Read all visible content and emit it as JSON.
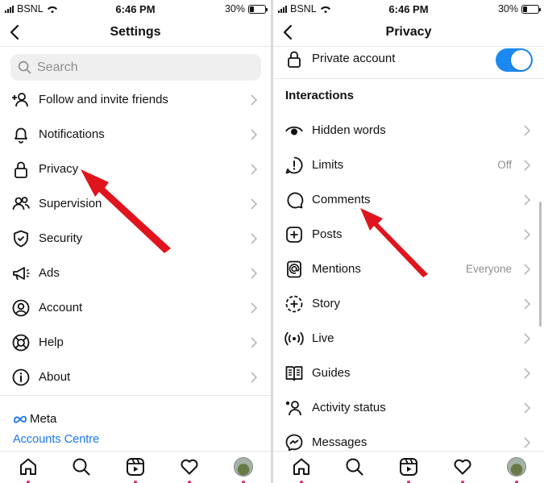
{
  "left": {
    "status": {
      "carrier": "BSNL",
      "time": "6:46 PM",
      "battery": "30%"
    },
    "header": {
      "title": "Settings"
    },
    "search": {
      "placeholder": "Search"
    },
    "items": [
      {
        "label": "Follow and invite friends",
        "icon": "add-person-icon"
      },
      {
        "label": "Notifications",
        "icon": "bell-icon"
      },
      {
        "label": "Privacy",
        "icon": "lock-icon"
      },
      {
        "label": "Supervision",
        "icon": "people-icon"
      },
      {
        "label": "Security",
        "icon": "shield-icon"
      },
      {
        "label": "Ads",
        "icon": "megaphone-icon"
      },
      {
        "label": "Account",
        "icon": "person-circle-icon"
      },
      {
        "label": "Help",
        "icon": "lifebuoy-icon"
      },
      {
        "label": "About",
        "icon": "info-icon"
      }
    ],
    "meta": {
      "brand": "Meta",
      "accounts_centre": "Accounts Centre"
    }
  },
  "right": {
    "status": {
      "carrier": "BSNL",
      "time": "6:46 PM",
      "battery": "30%"
    },
    "header": {
      "title": "Privacy"
    },
    "private_account": {
      "label": "Private account",
      "enabled": true
    },
    "section_title": "Interactions",
    "items": [
      {
        "label": "Hidden words",
        "icon": "eye-icon",
        "value": ""
      },
      {
        "label": "Limits",
        "icon": "alert-circle-icon",
        "value": "Off"
      },
      {
        "label": "Comments",
        "icon": "comment-icon",
        "value": ""
      },
      {
        "label": "Posts",
        "icon": "plus-square-icon",
        "value": ""
      },
      {
        "label": "Mentions",
        "icon": "at-icon",
        "value": "Everyone"
      },
      {
        "label": "Story",
        "icon": "story-add-icon",
        "value": ""
      },
      {
        "label": "Live",
        "icon": "live-icon",
        "value": ""
      },
      {
        "label": "Guides",
        "icon": "book-icon",
        "value": ""
      },
      {
        "label": "Activity status",
        "icon": "activity-person-icon",
        "value": ""
      },
      {
        "label": "Messages",
        "icon": "messenger-icon",
        "value": ""
      }
    ]
  },
  "tabs": [
    "home-icon",
    "search-icon",
    "reels-icon",
    "heart-icon",
    "profile-avatar"
  ],
  "colors": {
    "accent": "#1a8af2",
    "link": "#1877f2",
    "arrow": "#e0141c",
    "notification_dot": "#e1306c"
  },
  "battery_level": 0.3
}
